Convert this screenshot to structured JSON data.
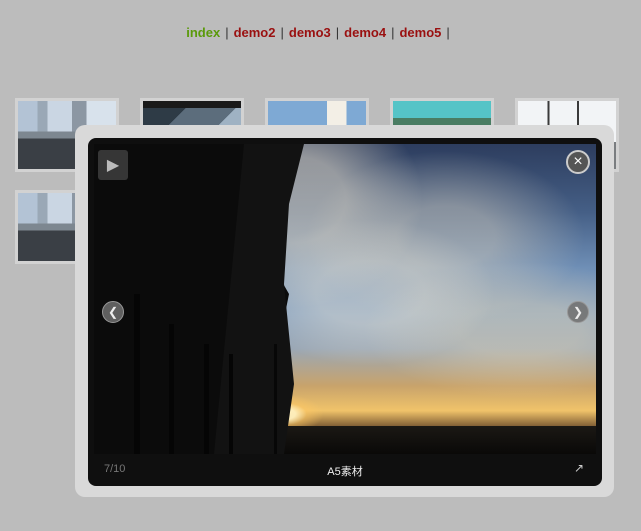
{
  "nav": {
    "links": [
      {
        "label": "index",
        "color": "#5a9a0a"
      },
      {
        "label": "demo2",
        "color": "#9a1010"
      },
      {
        "label": "demo3",
        "color": "#9a1010"
      },
      {
        "label": "demo4",
        "color": "#9a1010"
      },
      {
        "label": "demo5",
        "color": "#9a1010"
      }
    ],
    "separator": "|"
  },
  "gallery": {
    "thumbnails": [
      {
        "name": "thumb-city-1",
        "icon": "photo-city"
      },
      {
        "name": "thumb-boat",
        "icon": "photo-boat"
      },
      {
        "name": "thumb-tower",
        "icon": "photo-tower"
      },
      {
        "name": "thumb-water",
        "icon": "photo-water"
      },
      {
        "name": "thumb-ship",
        "icon": "photo-ship"
      },
      {
        "name": "thumb-city-2",
        "icon": "photo-city"
      }
    ]
  },
  "lightbox": {
    "counter": "7/10",
    "caption": "A5素材",
    "close_icon": "×",
    "play_icon": "▶",
    "prev_icon": "❮",
    "next_icon": "❯",
    "external_icon": "↗"
  }
}
